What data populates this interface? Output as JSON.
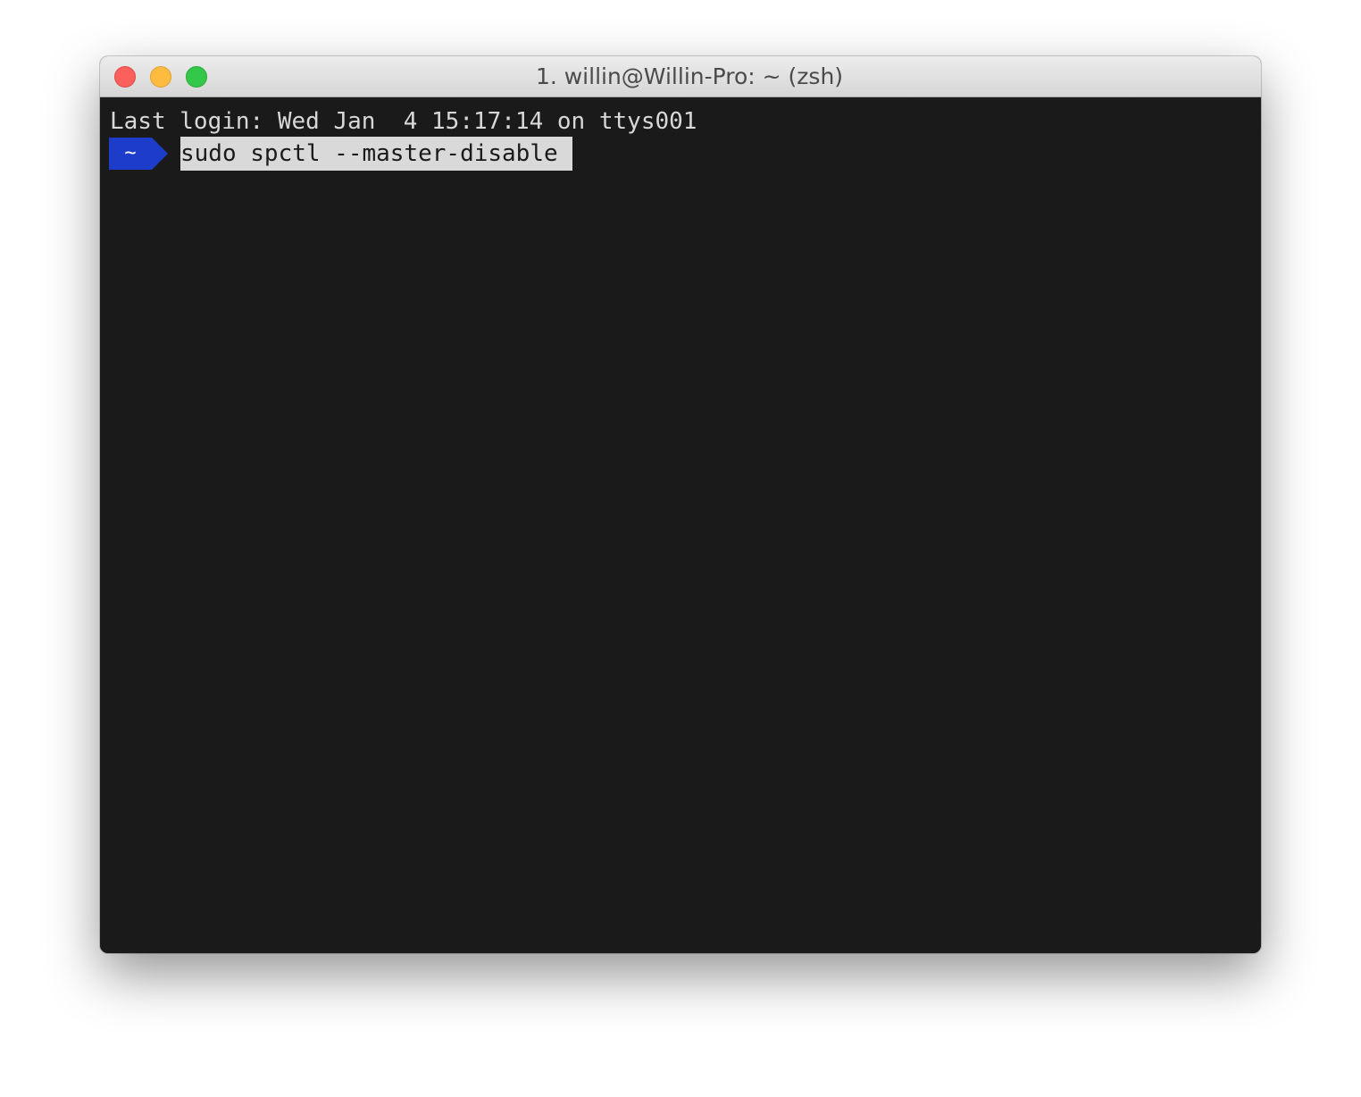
{
  "window": {
    "title": "1. willin@Willin-Pro: ~ (zsh)"
  },
  "terminal": {
    "last_login": "Last login: Wed Jan  4 15:17:14 on ttys001",
    "prompt_dir": "~",
    "command": "sudo spctl --master-disable"
  },
  "colors": {
    "prompt_segment": "#1d3cc9",
    "terminal_bg": "#1a1a1a",
    "selection_bg": "#d9d9d9",
    "close": "#fc605c",
    "minimize": "#fdbc40",
    "maximize": "#34c84a"
  }
}
